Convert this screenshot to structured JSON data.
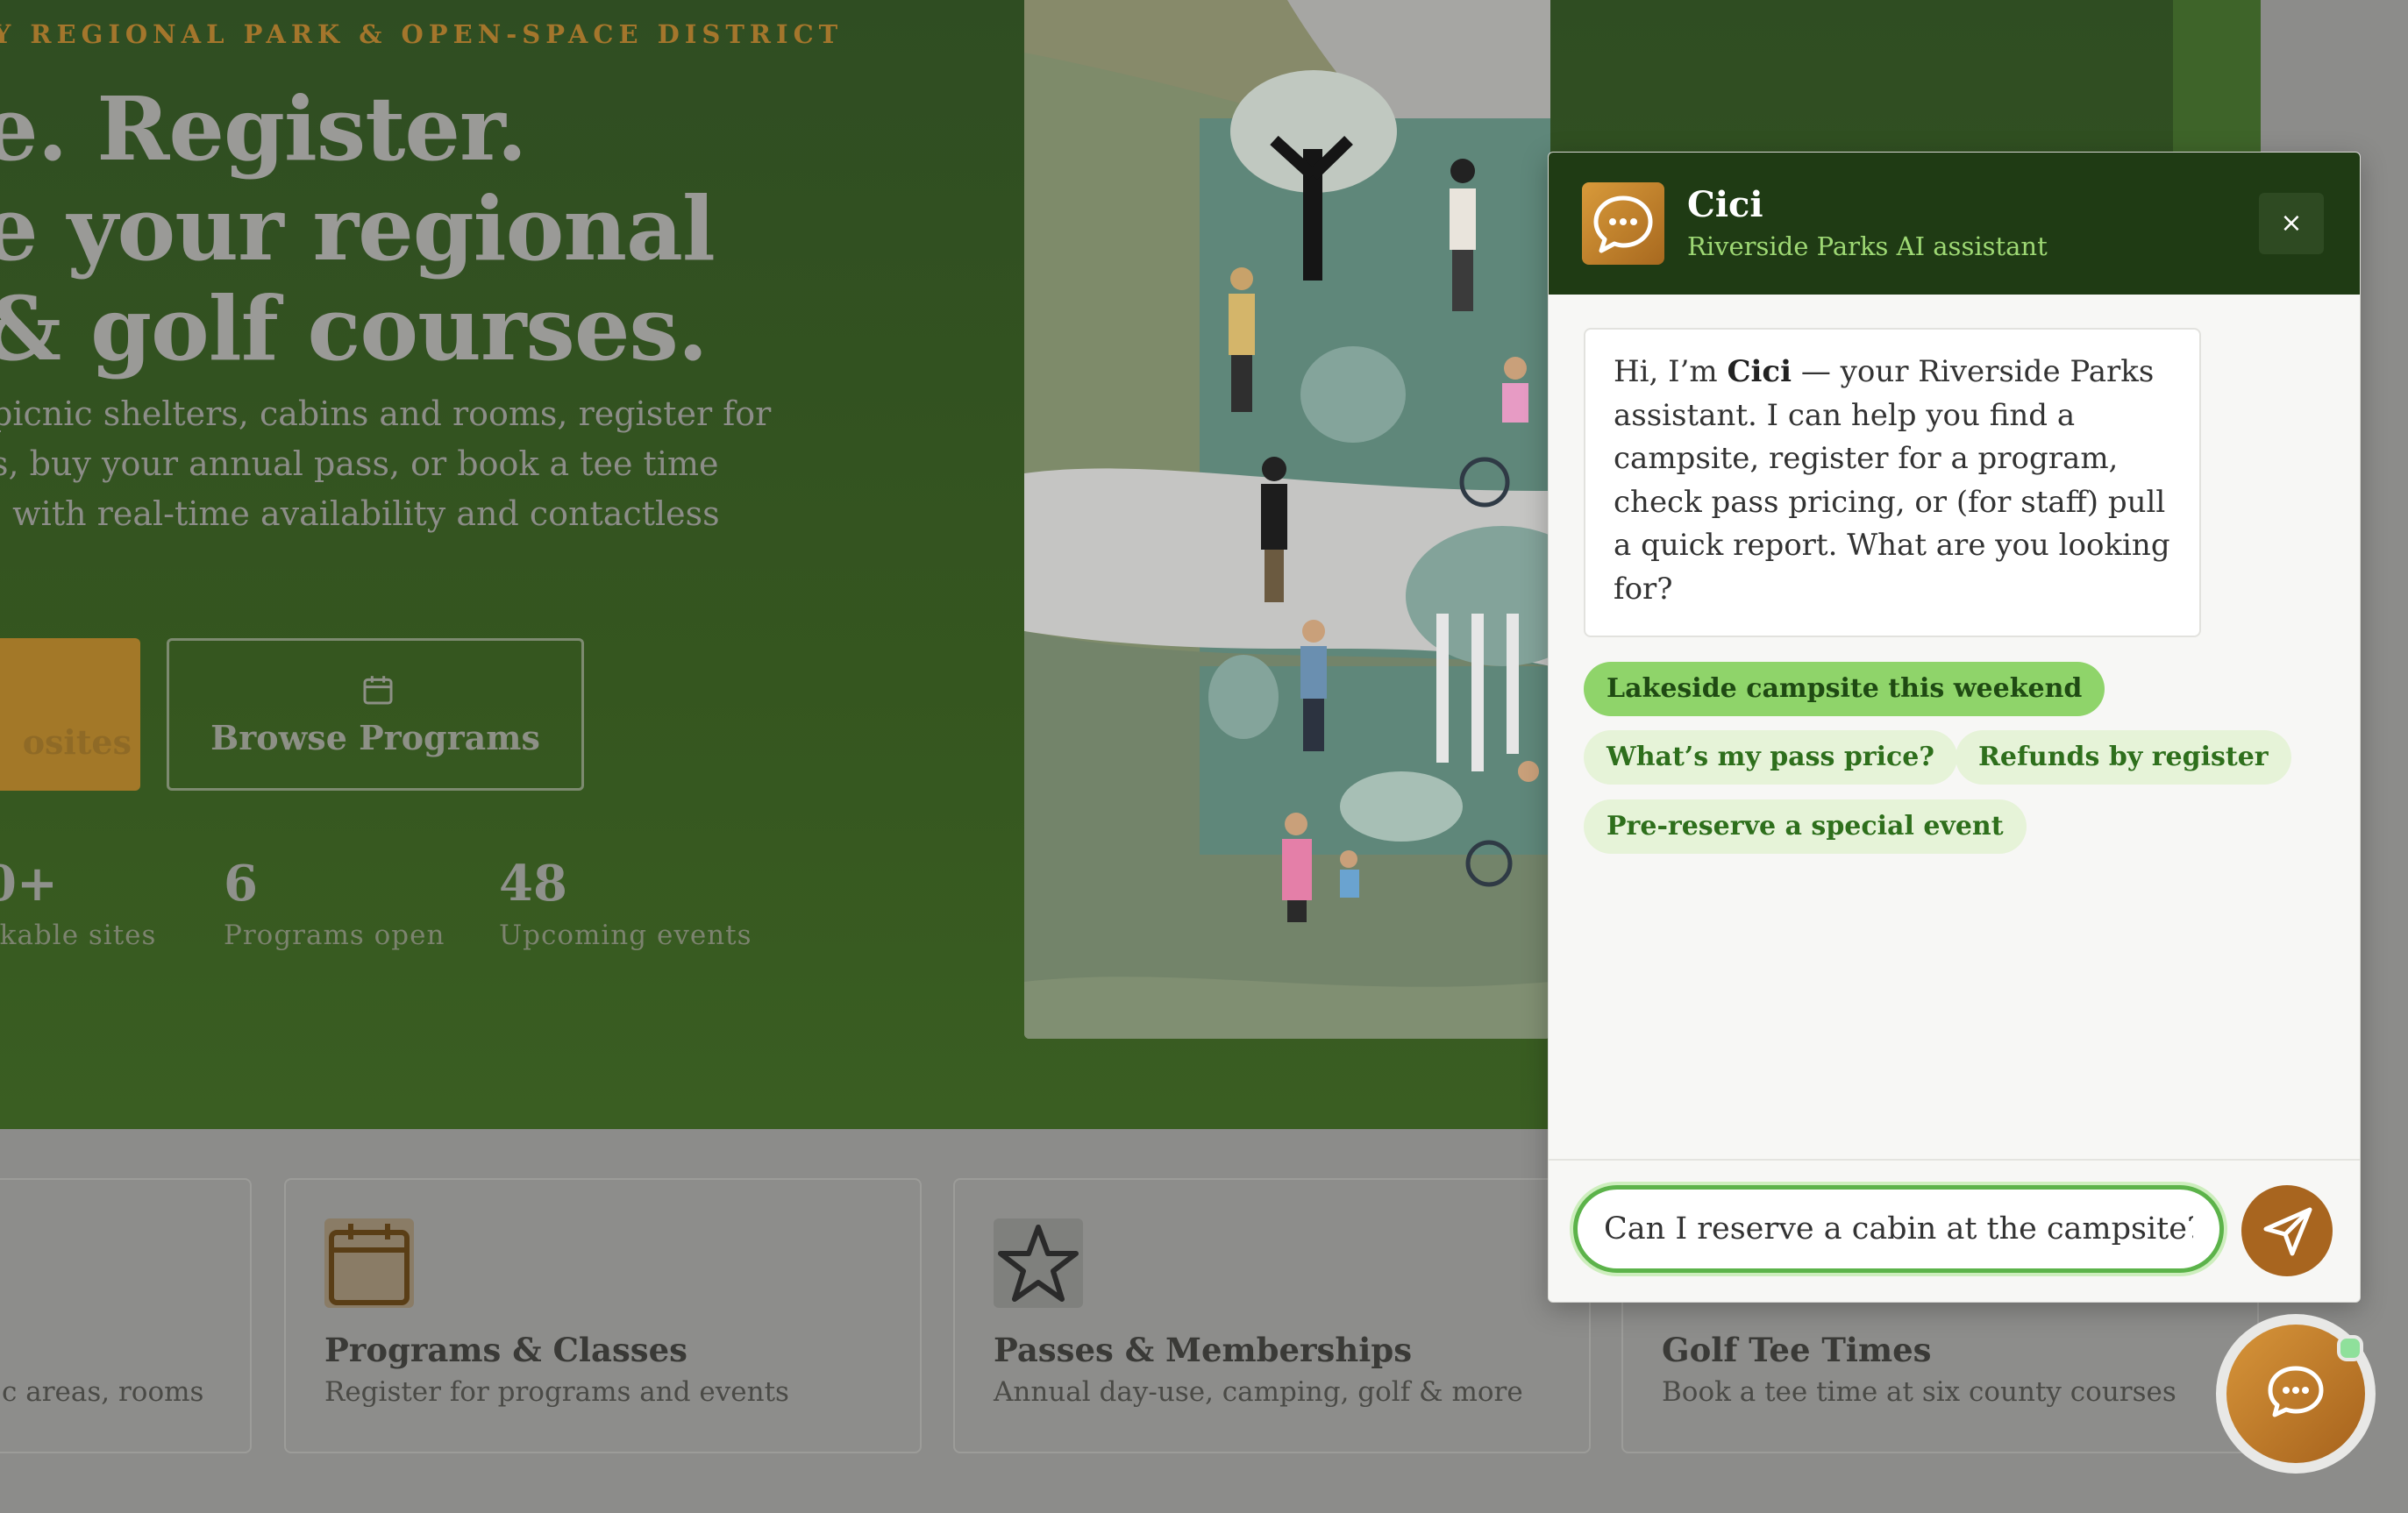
{
  "hero": {
    "kicker": "TY REGIONAL PARK & OPEN-SPACE DISTRICT",
    "title_lines": [
      "e. Register.",
      "e your regional",
      "& golf courses."
    ],
    "lead_lines": [
      "picnic shelters, cabins and rooms, register for",
      "s, buy your annual pass, or book a tee time",
      ", with real-time availability and contactless"
    ],
    "primary_button_label": "osites",
    "secondary_button_label": "Browse Programs",
    "stats": [
      {
        "value": "0+",
        "label": "okable sites"
      },
      {
        "value": "6",
        "label": "Programs open"
      },
      {
        "value": "48",
        "label": "Upcoming events"
      }
    ]
  },
  "cards": [
    {
      "title": "",
      "subtitle": "c areas, rooms",
      "icon": "none"
    },
    {
      "title": "Programs & Classes",
      "subtitle": "Register for programs and events",
      "icon": "calendar-icon"
    },
    {
      "title": "Passes & Memberships",
      "subtitle": "Annual day-use, camping, golf & more",
      "icon": "star-icon"
    },
    {
      "title": "Golf Tee Times",
      "subtitle": "Book a tee time at six county courses",
      "icon": "none"
    }
  ],
  "chat": {
    "name": "Cici",
    "subtitle": "Riverside Parks AI assistant",
    "close_label": "×",
    "greeting_pre": "Hi, I’m ",
    "greeting_name": "Cici",
    "greeting_post": " — your Riverside Parks assistant. I can help you find a campsite, register for a program, check pass pricing, or (for staff) pull a quick report. What are you looking for?",
    "suggestions": [
      "Lakeside campsite this weekend",
      "What’s my pass price?",
      "Refunds by register",
      "Pre-reserve a special event"
    ],
    "input_value": "Can I reserve a cabin at the campsite?",
    "colors": {
      "header": "#1f3b14",
      "accent": "#a8651f",
      "chip": "#e6f3d8",
      "chip_active": "#8fd46a"
    }
  }
}
